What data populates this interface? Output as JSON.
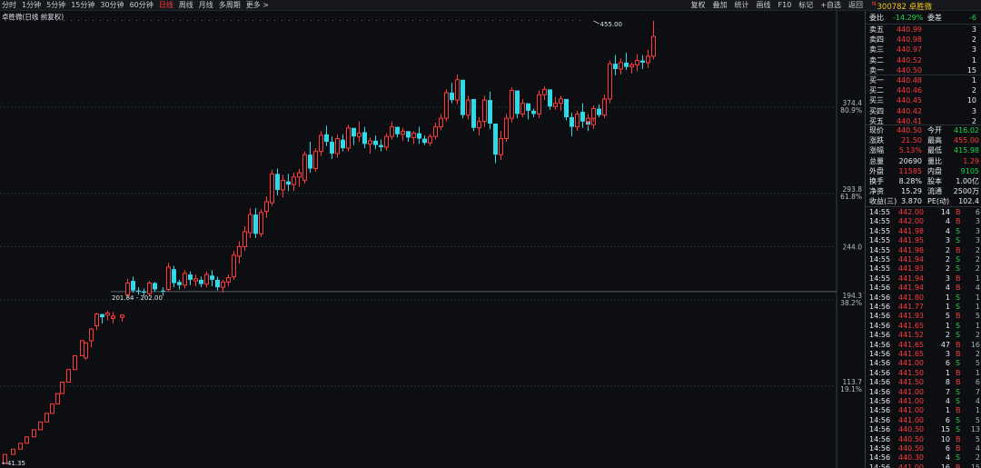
{
  "toolbar": {
    "periods": [
      "分时",
      "1分钟",
      "5分钟",
      "15分钟",
      "30分钟",
      "60分钟",
      "日线",
      "周线",
      "月线",
      "多周期",
      "更多 >"
    ],
    "active_index": 6,
    "tools": [
      "复权",
      "叠加",
      "统计",
      "画线",
      "F10",
      "标记",
      "+自选",
      "返回"
    ]
  },
  "stock": {
    "code": "300782",
    "name": "卓胜微",
    "market_mark": "N"
  },
  "chart": {
    "title": "卓胜微(日线 前复权)",
    "price_labels": [
      {
        "value": "374.4",
        "pct": "80.9%"
      },
      {
        "value": "293.8",
        "pct": "61.8%"
      },
      {
        "value": "244.0",
        "pct": ""
      },
      {
        "value": "194.3",
        "pct": "38.2%"
      },
      {
        "value": "113.7",
        "pct": "19.1%"
      }
    ],
    "max_label": "455.00",
    "min_label": "41.35",
    "range_label": "201.84 - 202.00"
  },
  "chart_data": {
    "type": "candlestick",
    "title": "卓胜微(日线 前复权)",
    "ylim": [
      41.35,
      455.0
    ],
    "y_ticks": [
      113.7,
      194.3,
      244.0,
      293.8,
      374.4
    ],
    "fib_levels": {
      "19.1%": 113.7,
      "38.2%": 194.3,
      "61.8%": 293.8,
      "80.9%": 374.4
    },
    "max": 455.0,
    "min": 41.35,
    "candles": [
      [
        41.35,
        49.76,
        41.35,
        49.76
      ],
      [
        49.76,
        54.74,
        49.76,
        54.74
      ],
      [
        54.74,
        60.21,
        54.74,
        60.21
      ],
      [
        60.21,
        66.23,
        60.21,
        66.23
      ],
      [
        66.23,
        72.85,
        66.23,
        72.85
      ],
      [
        72.85,
        80.14,
        72.85,
        80.14
      ],
      [
        80.14,
        88.15,
        80.14,
        88.15
      ],
      [
        88.15,
        96.97,
        88.15,
        96.97
      ],
      [
        96.97,
        106.67,
        96.97,
        106.67
      ],
      [
        106.67,
        117.34,
        106.67,
        117.34
      ],
      [
        117.34,
        129.07,
        117.34,
        129.07
      ],
      [
        129.07,
        141.98,
        129.07,
        141.98
      ],
      [
        141.98,
        156.18,
        141.98,
        156.18
      ],
      [
        140,
        155,
        138,
        154
      ],
      [
        156,
        168,
        150,
        167
      ],
      [
        170,
        182,
        166,
        181
      ],
      [
        181,
        180,
        172,
        178
      ],
      [
        180,
        184,
        175,
        182
      ],
      [
        177,
        183,
        172,
        179
      ],
      [
        178,
        181,
        174,
        180
      ],
      [
        199,
        214,
        197,
        210
      ],
      [
        212,
        216,
        201,
        203
      ],
      [
        203,
        206,
        199,
        202
      ],
      [
        202,
        205,
        198,
        201
      ],
      [
        200,
        212,
        198,
        210
      ],
      [
        210,
        211,
        202,
        204
      ],
      [
        203,
        206,
        198,
        202
      ],
      [
        204,
        229,
        202,
        225
      ],
      [
        223,
        226,
        206,
        210
      ],
      [
        211,
        213,
        204,
        208
      ],
      [
        208,
        222,
        205,
        219
      ],
      [
        218,
        221,
        208,
        213
      ],
      [
        212,
        218,
        207,
        214
      ],
      [
        213,
        216,
        206,
        209
      ],
      [
        209,
        221,
        206,
        218
      ],
      [
        217,
        222,
        207,
        213
      ],
      [
        213,
        216,
        203,
        206
      ],
      [
        206,
        213,
        201,
        211
      ],
      [
        211,
        218,
        207,
        215
      ],
      [
        216,
        240,
        213,
        236
      ],
      [
        235,
        249,
        228,
        244
      ],
      [
        244,
        263,
        240,
        258
      ],
      [
        257,
        280,
        252,
        274
      ],
      [
        274,
        280,
        252,
        256
      ],
      [
        256,
        279,
        253,
        276
      ],
      [
        277,
        291,
        271,
        286
      ],
      [
        285,
        316,
        282,
        312
      ],
      [
        312,
        317,
        292,
        297
      ],
      [
        297,
        311,
        290,
        306
      ],
      [
        305,
        312,
        296,
        302
      ],
      [
        302,
        313,
        296,
        309
      ],
      [
        309,
        317,
        300,
        313
      ],
      [
        306,
        333,
        303,
        330
      ],
      [
        330,
        342,
        313,
        317
      ],
      [
        317,
        336,
        314,
        333
      ],
      [
        333,
        352,
        329,
        348
      ],
      [
        349,
        357,
        338,
        342
      ],
      [
        342,
        347,
        326,
        331
      ],
      [
        331,
        349,
        327,
        345
      ],
      [
        344,
        349,
        333,
        336
      ],
      [
        336,
        358,
        333,
        355
      ],
      [
        355,
        353,
        339,
        347
      ],
      [
        347,
        361,
        342,
        350
      ],
      [
        351,
        356,
        336,
        340
      ],
      [
        340,
        346,
        331,
        343
      ],
      [
        343,
        348,
        335,
        339
      ],
      [
        339,
        344,
        333,
        337
      ],
      [
        337,
        350,
        334,
        347
      ],
      [
        347,
        361,
        344,
        356
      ],
      [
        356,
        354,
        346,
        349
      ],
      [
        349,
        355,
        343,
        352
      ],
      [
        352,
        349,
        342,
        346
      ],
      [
        346,
        352,
        340,
        350
      ],
      [
        350,
        356,
        340,
        345
      ],
      [
        345,
        348,
        339,
        341
      ],
      [
        341,
        349,
        338,
        347
      ],
      [
        347,
        360,
        344,
        356
      ],
      [
        356,
        368,
        353,
        364
      ],
      [
        364,
        391,
        361,
        388
      ],
      [
        388,
        397,
        378,
        381
      ],
      [
        381,
        405,
        377,
        400
      ],
      [
        400,
        384,
        364,
        367
      ],
      [
        367,
        385,
        363,
        381
      ],
      [
        382,
        374,
        352,
        355
      ],
      [
        355,
        365,
        348,
        361
      ],
      [
        361,
        385,
        356,
        381
      ],
      [
        381,
        389,
        354,
        359
      ],
      [
        359,
        331,
        322,
        330
      ],
      [
        330,
        352,
        325,
        345
      ],
      [
        345,
        368,
        342,
        364
      ],
      [
        364,
        393,
        360,
        390
      ],
      [
        390,
        384,
        364,
        368
      ],
      [
        368,
        382,
        365,
        378
      ],
      [
        378,
        376,
        363,
        371
      ],
      [
        371,
        373,
        365,
        368
      ],
      [
        368,
        390,
        364,
        386
      ],
      [
        386,
        394,
        381,
        391
      ],
      [
        391,
        384,
        372,
        375
      ],
      [
        375,
        384,
        372,
        378
      ],
      [
        378,
        385,
        371,
        382
      ],
      [
        382,
        380,
        362,
        365
      ],
      [
        365,
        369,
        347,
        356
      ],
      [
        356,
        371,
        352,
        368
      ],
      [
        368,
        378,
        356,
        361
      ],
      [
        361,
        364,
        352,
        358
      ],
      [
        358,
        374,
        354,
        370
      ],
      [
        370,
        378,
        355,
        361
      ],
      [
        361,
        368,
        356,
        364
      ],
      [
        364,
        376,
        361,
        373
      ],
      [
        373,
        377,
        365,
        367
      ],
      [
        367,
        386,
        364,
        382
      ],
      [
        382,
        418,
        378,
        415
      ],
      [
        415,
        423,
        404,
        410
      ],
      [
        410,
        420,
        405,
        416
      ],
      [
        416,
        425,
        409,
        412
      ],
      [
        412,
        416,
        406,
        414
      ],
      [
        414,
        424,
        408,
        418
      ],
      [
        418,
        423,
        410,
        416
      ],
      [
        416,
        428,
        411,
        422
      ],
      [
        422,
        455,
        419,
        440.5
      ]
    ],
    "x_positions": [
      3,
      12,
      20,
      27,
      35,
      42,
      49,
      55,
      61,
      66,
      73,
      80,
      88,
      92,
      98,
      104,
      110,
      116,
      122,
      132,
      138,
      144,
      150,
      156,
      162,
      168,
      177,
      183,
      189,
      195,
      201,
      207,
      213,
      219,
      225,
      231,
      237,
      243,
      249,
      255,
      261,
      267,
      273,
      279,
      285,
      291,
      297,
      303,
      309,
      315,
      321,
      327,
      333,
      339,
      345,
      351,
      357,
      363,
      369,
      375,
      381,
      387,
      393,
      399,
      405,
      411,
      417,
      423,
      429,
      435,
      441,
      447,
      453,
      459,
      465,
      471,
      477,
      483,
      489,
      495,
      501,
      507,
      513,
      519,
      525,
      531,
      537,
      543,
      549,
      555,
      561,
      567,
      573,
      579,
      585,
      591,
      597,
      603,
      609,
      615,
      621,
      627,
      633,
      639,
      645,
      651
    ]
  },
  "quote": {
    "weibi": {
      "label": "委比",
      "value": "-14.29%",
      "label2": "委差",
      "value2": "-6"
    },
    "sell": [
      {
        "label": "卖五",
        "price": "440.99",
        "vol": "3"
      },
      {
        "label": "卖四",
        "price": "440.98",
        "vol": "2"
      },
      {
        "label": "卖三",
        "price": "440.97",
        "vol": "3"
      },
      {
        "label": "卖二",
        "price": "440.52",
        "vol": "1"
      },
      {
        "label": "卖一",
        "price": "440.50",
        "vol": "15"
      }
    ],
    "buy": [
      {
        "label": "买一",
        "price": "440.48",
        "vol": "1"
      },
      {
        "label": "买二",
        "price": "440.46",
        "vol": "2"
      },
      {
        "label": "买三",
        "price": "440.45",
        "vol": "10"
      },
      {
        "label": "买四",
        "price": "440.42",
        "vot": "",
        "vol": "3"
      },
      {
        "label": "买五",
        "price": "440.41",
        "vol": "2"
      }
    ],
    "stats": [
      {
        "l1": "现价",
        "v1": "440.50",
        "c1": "red",
        "l2": "今开",
        "v2": "416.02",
        "c2": "grn"
      },
      {
        "l1": "涨跌",
        "v1": "21.50",
        "c1": "red",
        "l2": "最高",
        "v2": "455.00",
        "c2": "red"
      },
      {
        "l1": "涨幅",
        "v1": "5.13%",
        "c1": "red",
        "l2": "最低",
        "v2": "415.98",
        "c2": "grn"
      },
      {
        "l1": "总量",
        "v1": "20690",
        "c1": "wht",
        "l2": "量比",
        "v2": "1.29",
        "c2": "red"
      },
      {
        "l1": "外盘",
        "v1": "11585",
        "c1": "red",
        "l2": "内盘",
        "v2": "9105",
        "c2": "grn"
      },
      {
        "l1": "换手",
        "v1": "8.28%",
        "c1": "wht",
        "l2": "股本",
        "v2": "1.00亿",
        "c2": "wht"
      },
      {
        "l1": "净资",
        "v1": "15.29",
        "c1": "wht",
        "l2": "流通",
        "v2": "2500万",
        "c2": "wht"
      },
      {
        "l1": "收益(三)",
        "v1": "3.870",
        "c1": "wht",
        "l2": "PE(动)",
        "v2": "102.4",
        "c2": "wht"
      }
    ]
  },
  "ticks": [
    {
      "time": "14:55",
      "price": "442.00",
      "vol": "14",
      "bs": "B",
      "n": "6"
    },
    {
      "time": "14:55",
      "price": "442.00",
      "vol": "4",
      "bs": "B",
      "n": "3"
    },
    {
      "time": "14:55",
      "price": "441.98",
      "vol": "4",
      "bs": "S",
      "n": "3"
    },
    {
      "time": "14:55",
      "price": "441.95",
      "vol": "3",
      "bs": "S",
      "n": "3"
    },
    {
      "time": "14:55",
      "price": "441.98",
      "vol": "2",
      "bs": "B",
      "n": "2"
    },
    {
      "time": "14:55",
      "price": "441.94",
      "vol": "2",
      "bs": "S",
      "n": "2"
    },
    {
      "time": "14:55",
      "price": "441.93",
      "vol": "2",
      "bs": "S",
      "n": "2"
    },
    {
      "time": "14:55",
      "price": "441.94",
      "vol": "3",
      "bs": "B",
      "n": "1"
    },
    {
      "time": "14:56",
      "price": "441.94",
      "vol": "4",
      "bs": "B",
      "n": "4"
    },
    {
      "time": "14:56",
      "price": "441.80",
      "vol": "1",
      "bs": "S",
      "n": "1"
    },
    {
      "time": "14:56",
      "price": "441.77",
      "vol": "1",
      "bs": "S",
      "n": "1"
    },
    {
      "time": "14:56",
      "price": "441.93",
      "vol": "5",
      "bs": "B",
      "n": "5"
    },
    {
      "time": "14:56",
      "price": "441.65",
      "vol": "1",
      "bs": "S",
      "n": "1"
    },
    {
      "time": "14:56",
      "price": "441.52",
      "vol": "2",
      "bs": "S",
      "n": "2"
    },
    {
      "time": "14:56",
      "price": "441.65",
      "vol": "47",
      "bs": "B",
      "n": "16"
    },
    {
      "time": "14:56",
      "price": "441.65",
      "vol": "3",
      "bs": "B",
      "n": "2"
    },
    {
      "time": "14:56",
      "price": "441.00",
      "vol": "6",
      "bs": "S",
      "n": "5"
    },
    {
      "time": "14:56",
      "price": "441.50",
      "vol": "1",
      "bs": "B",
      "n": "1"
    },
    {
      "time": "14:56",
      "price": "441.50",
      "vol": "8",
      "bs": "B",
      "n": "6"
    },
    {
      "time": "14:56",
      "price": "441.00",
      "vol": "7",
      "bs": "S",
      "n": "7"
    },
    {
      "time": "14:56",
      "price": "441.00",
      "vol": "4",
      "bs": "S",
      "n": "4"
    },
    {
      "time": "14:56",
      "price": "441.00",
      "vol": "1",
      "bs": "B",
      "n": "1"
    },
    {
      "time": "14:56",
      "price": "441.00",
      "vol": "6",
      "bs": "S",
      "n": "5"
    },
    {
      "time": "14:56",
      "price": "440.50",
      "vol": "15",
      "bs": "S",
      "n": "13"
    },
    {
      "time": "14:56",
      "price": "440.50",
      "vol": "10",
      "bs": "B",
      "n": "5"
    },
    {
      "time": "14:56",
      "price": "440.50",
      "vol": "6",
      "bs": "B",
      "n": "4"
    },
    {
      "time": "14:56",
      "price": "440.30",
      "vol": "4",
      "bs": "S",
      "n": "2"
    },
    {
      "time": "14:56",
      "price": "441.00",
      "vol": "16",
      "bs": "B",
      "n": "15"
    }
  ],
  "colors": {
    "up": "#ff3b3b",
    "down": "#2ed9e8",
    "grid": "#2a2e36",
    "axis": "#3a3f48",
    "bg": "#0c0e12"
  }
}
